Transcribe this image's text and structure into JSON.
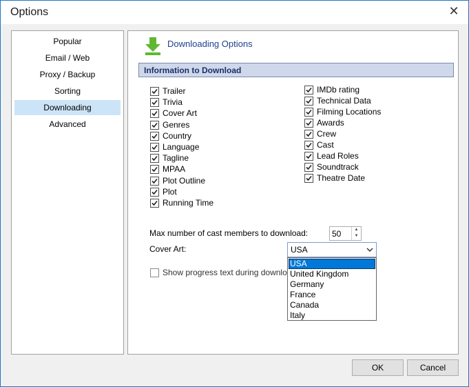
{
  "window": {
    "title": "Options",
    "close_glyph": "✕"
  },
  "sidebar": {
    "items": [
      {
        "label": "Popular"
      },
      {
        "label": "Email / Web"
      },
      {
        "label": "Proxy / Backup"
      },
      {
        "label": "Sorting"
      },
      {
        "label": "Downloading",
        "selected": true
      },
      {
        "label": "Advanced"
      }
    ]
  },
  "main": {
    "heading": "Downloading Options",
    "heading_icon": "download-arrow-icon",
    "section_title": "Information to Download",
    "left_checks": [
      {
        "label": "Trailer",
        "checked": true
      },
      {
        "label": "Trivia",
        "checked": true
      },
      {
        "label": "Cover Art",
        "checked": true
      },
      {
        "label": "Genres",
        "checked": true
      },
      {
        "label": "Country",
        "checked": true
      },
      {
        "label": "Language",
        "checked": true
      },
      {
        "label": "Tagline",
        "checked": true
      },
      {
        "label": "MPAA",
        "checked": true
      },
      {
        "label": "Plot Outline",
        "checked": true
      },
      {
        "label": "Plot",
        "checked": true
      },
      {
        "label": "Running Time",
        "checked": true
      }
    ],
    "right_checks": [
      {
        "label": "IMDb rating",
        "checked": true
      },
      {
        "label": "Technical Data",
        "checked": true
      },
      {
        "label": "Filming Locations",
        "checked": true
      },
      {
        "label": "Awards",
        "checked": true
      },
      {
        "label": "Crew",
        "checked": true
      },
      {
        "label": "Cast",
        "checked": true
      },
      {
        "label": "Lead Roles",
        "checked": true
      },
      {
        "label": "Soundtrack",
        "checked": true
      },
      {
        "label": "Theatre Date",
        "checked": true
      }
    ],
    "max_cast_label": "Max number of cast members to download:",
    "max_cast_value": "50",
    "cover_art_label": "Cover Art:",
    "cover_art_value": "USA",
    "cover_art_options": [
      "USA",
      "United Kingdom",
      "Germany",
      "France",
      "Canada",
      "Italy"
    ],
    "show_progress_label": "Show progress text during downlo",
    "show_progress_checked": false
  },
  "footer": {
    "ok_label": "OK",
    "cancel_label": "Cancel"
  },
  "colors": {
    "accent": "#0078d7",
    "selection": "#cce4f7",
    "section_bg": "#cfd8ea",
    "heading": "#1f3f8f",
    "icon_green": "#5fb832"
  }
}
